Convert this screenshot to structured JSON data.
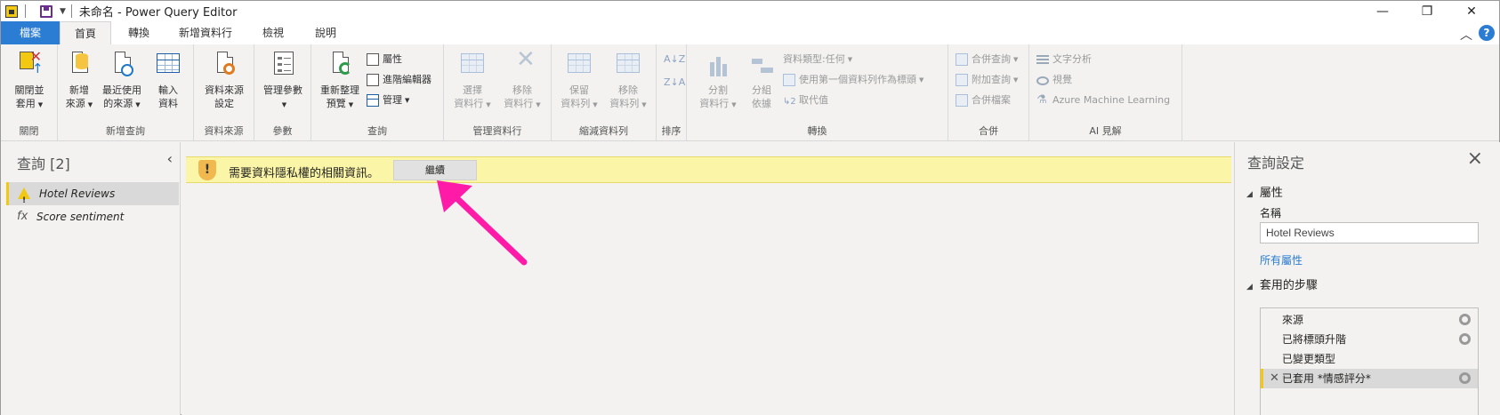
{
  "window": {
    "title": "未命名 - Power Query Editor",
    "minimize": "—",
    "restore": "❐",
    "close": "✕"
  },
  "tabs": [
    {
      "label": "檔案"
    },
    {
      "label": "首頁"
    },
    {
      "label": "轉換"
    },
    {
      "label": "新增資料行"
    },
    {
      "label": "檢視"
    },
    {
      "label": "說明"
    }
  ],
  "ribbon": {
    "close_apply": {
      "line1": "關閉並",
      "line2": "套用",
      "group": "關閉"
    },
    "new_query": {
      "new_source": {
        "line1": "新增",
        "line2": "來源"
      },
      "recent": {
        "line1": "最近使用",
        "line2": "的來源"
      },
      "enter_data": {
        "line1": "輸入",
        "line2": "資料"
      },
      "group": "新增查詢"
    },
    "data_source": {
      "line1": "資料來源",
      "line2": "設定",
      "group": "資料來源"
    },
    "params": {
      "line1": "管理參數",
      "group": "參數"
    },
    "query": {
      "refresh": {
        "line1": "重新整理",
        "line2": "預覽"
      },
      "properties": "屬性",
      "advanced_editor": "進階編輯器",
      "manage": "管理",
      "group": "查詢"
    },
    "manage_columns": {
      "choose": {
        "line1": "選擇",
        "line2": "資料行"
      },
      "remove": {
        "line1": "移除",
        "line2": "資料行"
      },
      "group": "管理資料行"
    },
    "reduce_rows": {
      "keep": {
        "line1": "保留",
        "line2": "資料列"
      },
      "remove": {
        "line1": "移除",
        "line2": "資料列"
      },
      "group": "縮減資料列"
    },
    "sort": {
      "group": "排序"
    },
    "transform": {
      "split": {
        "line1": "分割",
        "line2": "資料行"
      },
      "group_by": {
        "line1": "分組",
        "line2": "依據"
      },
      "data_type": "資料類型:任何",
      "use_first_row": "使用第一個資料列作為標頭",
      "replace": "取代值",
      "group": "轉換"
    },
    "combine": {
      "merge": "合併查詢",
      "append": "附加查詢",
      "combine_files": "合併檔案",
      "group": "合併"
    },
    "ai": {
      "text_analytics": "文字分析",
      "vision": "視覺",
      "azure_ml": "Azure Machine Learning",
      "group": "AI 見解"
    }
  },
  "queries_pane": {
    "title": "查詢 [2]",
    "items": [
      {
        "label": "Hotel Reviews",
        "icon": "warning-icon"
      },
      {
        "label": "Score sentiment",
        "icon": "fx-icon"
      }
    ]
  },
  "banner": {
    "message": "需要資料隱私權的相關資訊。",
    "button": "繼續"
  },
  "settings_pane": {
    "title": "查詢設定",
    "properties_header": "屬性",
    "name_label": "名稱",
    "name_value": "Hotel Reviews",
    "all_properties": "所有屬性",
    "steps_header": "套用的步驟",
    "steps": [
      {
        "label": "來源"
      },
      {
        "label": "已將標頭升階"
      },
      {
        "label": "已變更類型"
      },
      {
        "label": "已套用 *情感評分*"
      }
    ]
  },
  "colors": {
    "accent": "#2b7cd3",
    "banner_bg": "#fbf5a7",
    "annotation_arrow": "#ff1aa8"
  }
}
